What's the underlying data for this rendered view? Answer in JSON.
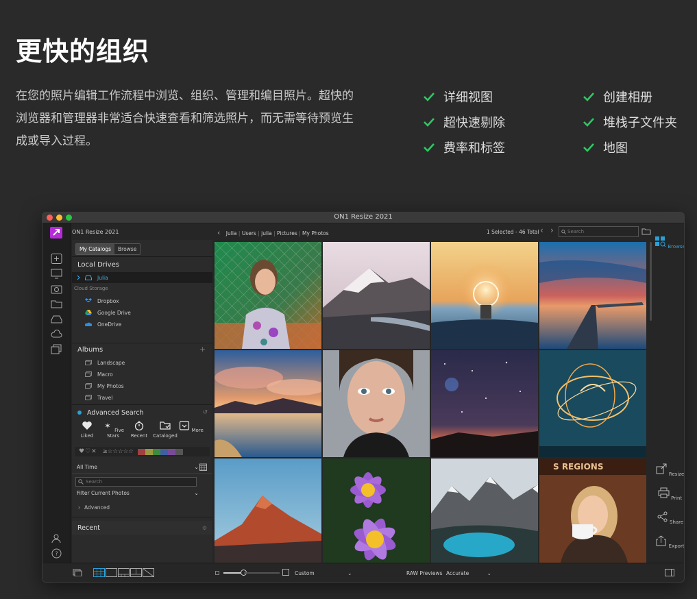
{
  "marketing": {
    "title": "更快的组织",
    "description": "在您的照片编辑工作流程中浏览、组织、管理和编目照片。超快的浏览器和管理器非常适合快速查看和筛选照片，而无需等待预览生成或导入过程。",
    "features_left": [
      "详细视图",
      "超快速剔除",
      "费率和标签"
    ],
    "features_right": [
      "创建相册",
      "堆栈子文件夹",
      "地图"
    ],
    "check_color": "#2fc863"
  },
  "window": {
    "title": "ON1 Resize 2021",
    "app_name": "ON1 Resize 2021"
  },
  "panel": {
    "tabs": [
      "My Catalogs",
      "Browse"
    ],
    "local_drives_label": "Local Drives",
    "drive": "Julia",
    "cloud_label": "Cloud Storage",
    "cloud_items": [
      "Dropbox",
      "Google Drive",
      "OneDrive"
    ],
    "albums_label": "Albums",
    "albums": [
      "Landscape",
      "Macro",
      "My Photos",
      "Travel"
    ],
    "advanced_search_label": "Advanced Search",
    "quick_filters": [
      "Liked",
      "Five Stars",
      "Recent",
      "Cataloged",
      "More"
    ],
    "time_filter": "All Time",
    "search_placeholder": "Search",
    "filter_label": "Filter Current Photos",
    "advanced_label": "Advanced",
    "recent_label": "Recent"
  },
  "browser": {
    "breadcrumb": [
      "Julia",
      "Users",
      "julia",
      "Pictures",
      "My Photos"
    ],
    "selection": "1 Selected - 46 Total",
    "search_placeholder": "Search",
    "mode_label": "Browse",
    "tools": [
      "Resize",
      "Print",
      "Share",
      "Export"
    ]
  },
  "bottom": {
    "view_mode": "Custom",
    "raw_label": "RAW Previews",
    "raw_value": "Accurate"
  },
  "accent_color": "#2aa0d8"
}
